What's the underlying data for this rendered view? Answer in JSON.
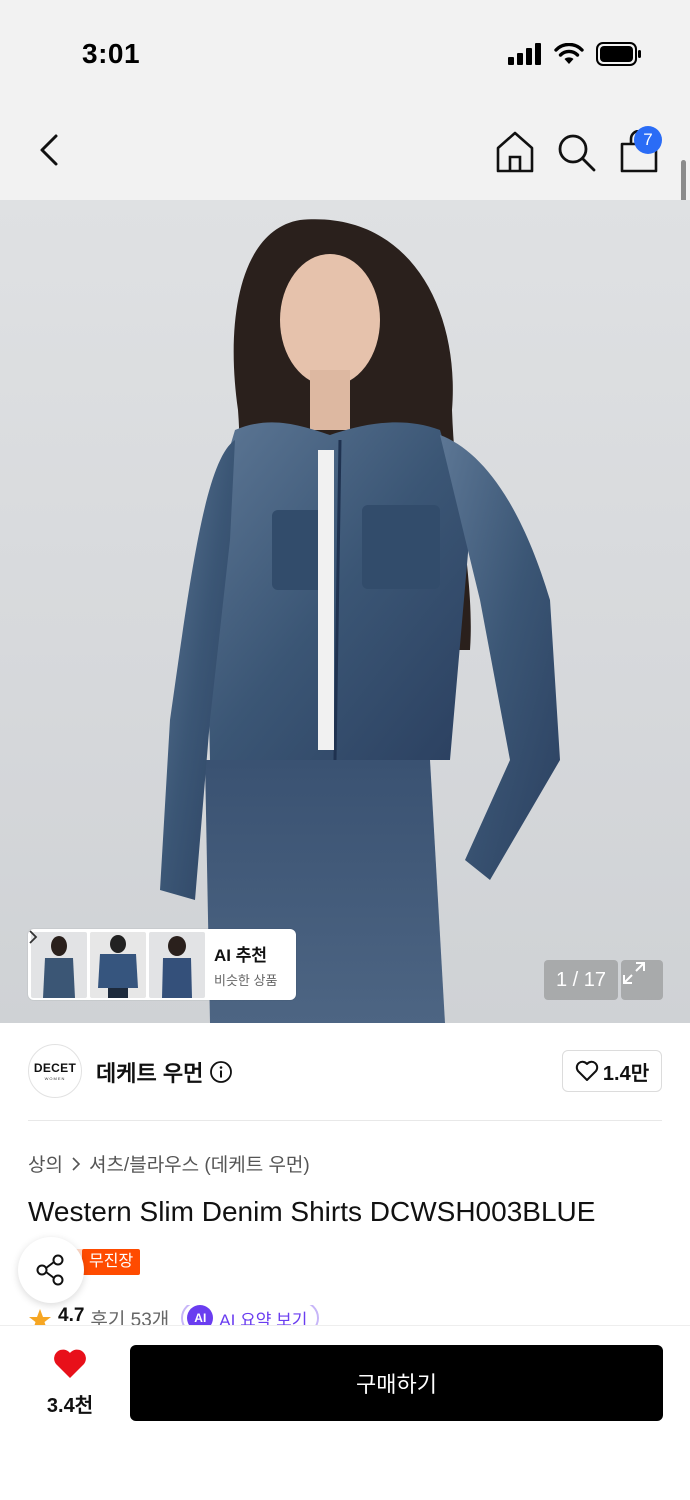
{
  "status_bar": {
    "time": "3:01"
  },
  "nav": {
    "cart_count": "7"
  },
  "gallery": {
    "counter": "1 / 17",
    "ai_recommend": {
      "title": "AI 추천",
      "subtitle": "비슷한 상품"
    }
  },
  "brand": {
    "logo_text": "DECET",
    "logo_sub": "WOMEN",
    "name": "데케트 우먼",
    "likes": "1.4만"
  },
  "breadcrumb": {
    "category": "상의",
    "subcategory": "셔츠/블라우스 (데케트 우먼)"
  },
  "product": {
    "title": "Western Slim Denim Shirts DCWSH003BLUE",
    "shipping_badge": "무진장",
    "rating": "4.7",
    "reviews": "후기 53개",
    "ai_summary_label": "AI 요약 보기"
  },
  "bottom_bar": {
    "favorite_count": "3.4천",
    "buy_label": "구매하기"
  },
  "colors": {
    "accent_blue": "#2a6cf6",
    "badge_orange": "#ff4b00",
    "heart_red": "#e8101a",
    "ai_purple": "#6a3df0"
  }
}
